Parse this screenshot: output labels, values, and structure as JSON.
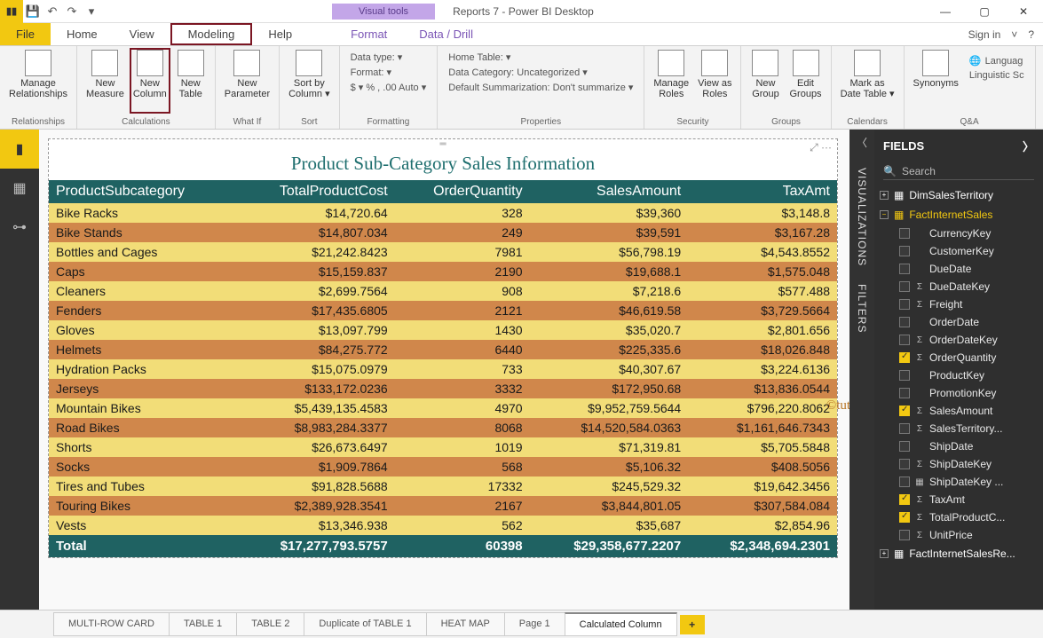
{
  "titlebar": {
    "visual_tools": "Visual tools",
    "document": "Reports 7 - Power BI Desktop",
    "signin": "Sign in"
  },
  "tabs": {
    "file": "File",
    "home": "Home",
    "view": "View",
    "modeling": "Modeling",
    "help": "Help",
    "format": "Format",
    "data": "Data / Drill"
  },
  "ribbon": {
    "manage_relationships": "Manage\nRelationships",
    "relationships_group": "Relationships",
    "new_measure": "New\nMeasure",
    "new_column": "New\nColumn",
    "new_table": "New\nTable",
    "calculations_group": "Calculations",
    "new_parameter": "New\nParameter",
    "whatif_group": "What If",
    "sort_by": "Sort by\nColumn ▾",
    "sort_group": "Sort",
    "data_type": "Data type:  ▾",
    "format": "Format:  ▾",
    "currency": "$ ▾  %   ,   .00   Auto ▾",
    "formatting_group": "Formatting",
    "home_table": "Home Table:  ▾",
    "data_category": "Data Category: Uncategorized ▾",
    "summarization": "Default Summarization: Don't summarize ▾",
    "properties_group": "Properties",
    "manage_roles": "Manage\nRoles",
    "view_as": "View as\nRoles",
    "security_group": "Security",
    "new_group": "New\nGroup",
    "edit_groups": "Edit\nGroups",
    "groups_group": "Groups",
    "mark_as": "Mark as\nDate Table ▾",
    "calendars_group": "Calendars",
    "synonyms": "Synonyms",
    "language": "Languag",
    "linguistic": "Linguistic Sc",
    "qa_group": "Q&A"
  },
  "visual": {
    "title": "Product Sub-Category Sales Information",
    "headers": [
      "ProductSubcategory",
      "TotalProductCost",
      "OrderQuantity",
      "SalesAmount",
      "TaxAmt"
    ],
    "rows": [
      [
        "Bike Racks",
        "$14,720.64",
        "328",
        "$39,360",
        "$3,148.8"
      ],
      [
        "Bike Stands",
        "$14,807.034",
        "249",
        "$39,591",
        "$3,167.28"
      ],
      [
        "Bottles and Cages",
        "$21,242.8423",
        "7981",
        "$56,798.19",
        "$4,543.8552"
      ],
      [
        "Caps",
        "$15,159.837",
        "2190",
        "$19,688.1",
        "$1,575.048"
      ],
      [
        "Cleaners",
        "$2,699.7564",
        "908",
        "$7,218.6",
        "$577.488"
      ],
      [
        "Fenders",
        "$17,435.6805",
        "2121",
        "$46,619.58",
        "$3,729.5664"
      ],
      [
        "Gloves",
        "$13,097.799",
        "1430",
        "$35,020.7",
        "$2,801.656"
      ],
      [
        "Helmets",
        "$84,275.772",
        "6440",
        "$225,335.6",
        "$18,026.848"
      ],
      [
        "Hydration Packs",
        "$15,075.0979",
        "733",
        "$40,307.67",
        "$3,224.6136"
      ],
      [
        "Jerseys",
        "$133,172.0236",
        "3332",
        "$172,950.68",
        "$13,836.0544"
      ],
      [
        "Mountain Bikes",
        "$5,439,135.4583",
        "4970",
        "$9,952,759.5644",
        "$796,220.8062"
      ],
      [
        "Road Bikes",
        "$8,983,284.3377",
        "8068",
        "$14,520,584.0363",
        "$1,161,646.7343"
      ],
      [
        "Shorts",
        "$26,673.6497",
        "1019",
        "$71,319.81",
        "$5,705.5848"
      ],
      [
        "Socks",
        "$1,909.7864",
        "568",
        "$5,106.32",
        "$408.5056"
      ],
      [
        "Tires and Tubes",
        "$91,828.5688",
        "17332",
        "$245,529.32",
        "$19,642.3456"
      ],
      [
        "Touring Bikes",
        "$2,389,928.3541",
        "2167",
        "$3,844,801.05",
        "$307,584.084"
      ],
      [
        "Vests",
        "$13,346.938",
        "562",
        "$35,687",
        "$2,854.96"
      ]
    ],
    "total": [
      "Total",
      "$17,277,793.5757",
      "60398",
      "$29,358,677.2207",
      "$2,348,694.2301"
    ]
  },
  "watermark": "©tutorialgateway.org",
  "sidepanels": {
    "viz": "VISUALIZATIONS",
    "filters": "FILTERS"
  },
  "fields": {
    "title": "FIELDS",
    "search": "Search",
    "tables": [
      {
        "name": "DimSalesTerritory",
        "expanded": false
      },
      {
        "name": "FactInternetSales",
        "expanded": true,
        "columns": [
          {
            "name": "CurrencyKey",
            "chk": false,
            "sig": ""
          },
          {
            "name": "CustomerKey",
            "chk": false,
            "sig": ""
          },
          {
            "name": "DueDate",
            "chk": false,
            "sig": ""
          },
          {
            "name": "DueDateKey",
            "chk": false,
            "sig": "Σ"
          },
          {
            "name": "Freight",
            "chk": false,
            "sig": "Σ"
          },
          {
            "name": "OrderDate",
            "chk": false,
            "sig": ""
          },
          {
            "name": "OrderDateKey",
            "chk": false,
            "sig": "Σ"
          },
          {
            "name": "OrderQuantity",
            "chk": true,
            "sig": "Σ"
          },
          {
            "name": "ProductKey",
            "chk": false,
            "sig": ""
          },
          {
            "name": "PromotionKey",
            "chk": false,
            "sig": ""
          },
          {
            "name": "SalesAmount",
            "chk": true,
            "sig": "Σ"
          },
          {
            "name": "SalesTerritory...",
            "chk": false,
            "sig": "Σ"
          },
          {
            "name": "ShipDate",
            "chk": false,
            "sig": ""
          },
          {
            "name": "ShipDateKey",
            "chk": false,
            "sig": "Σ"
          },
          {
            "name": "ShipDateKey ...",
            "chk": false,
            "sig": "▦"
          },
          {
            "name": "TaxAmt",
            "chk": true,
            "sig": "Σ"
          },
          {
            "name": "TotalProductC...",
            "chk": true,
            "sig": "Σ"
          },
          {
            "name": "UnitPrice",
            "chk": false,
            "sig": "Σ"
          }
        ]
      },
      {
        "name": "FactInternetSalesRe...",
        "expanded": false
      }
    ]
  },
  "pages": {
    "items": [
      "MULTI-ROW CARD",
      "TABLE 1",
      "TABLE 2",
      "Duplicate of TABLE 1",
      "HEAT MAP",
      "Page 1",
      "Calculated Column"
    ],
    "active": 6
  }
}
